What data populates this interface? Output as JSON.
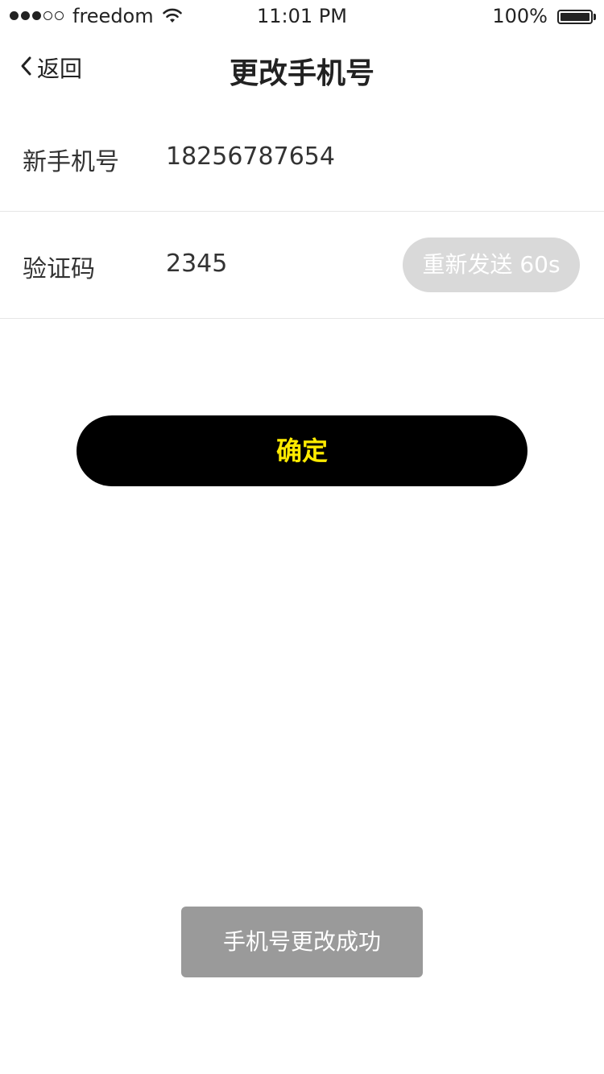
{
  "status_bar": {
    "carrier": "freedom",
    "time": "11:01 PM",
    "battery": "100%",
    "battery_level": 1.0,
    "signal_strength": 3,
    "signal_max": 5
  },
  "nav": {
    "back_label": "返回",
    "title": "更改手机号",
    "back_icon": "chevron-left-icon"
  },
  "form": {
    "phone": {
      "label": "新手机号",
      "value": "18256787654"
    },
    "code": {
      "label": "验证码",
      "value": "2345",
      "resend_label": "重新发送 60s"
    }
  },
  "confirm_label": "确定",
  "toast": "手机号更改成功",
  "colors": {
    "confirm_bg": "#000000",
    "confirm_text": "#ffeb00",
    "resend_bg": "#d9d9d9",
    "toast_bg": "#9a9a9a"
  }
}
